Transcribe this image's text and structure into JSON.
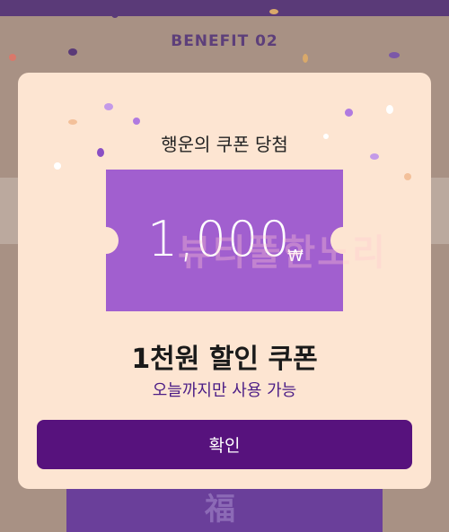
{
  "background": {
    "benefit_title": "BENEFIT 02",
    "card_glyph": "福"
  },
  "modal": {
    "title": "행운의 쿠폰 당첨",
    "coupon": {
      "amount": "1,000",
      "unit": "₩",
      "watermark": "뷰티풀한노리"
    },
    "coupon_name": "1천원 할인 쿠폰",
    "coupon_sub": "오늘까지만 사용 가능",
    "confirm_label": "확인"
  },
  "colors": {
    "accent": "#57127d",
    "coupon": "#a15fcf",
    "modal_bg": "#fde5d2"
  }
}
